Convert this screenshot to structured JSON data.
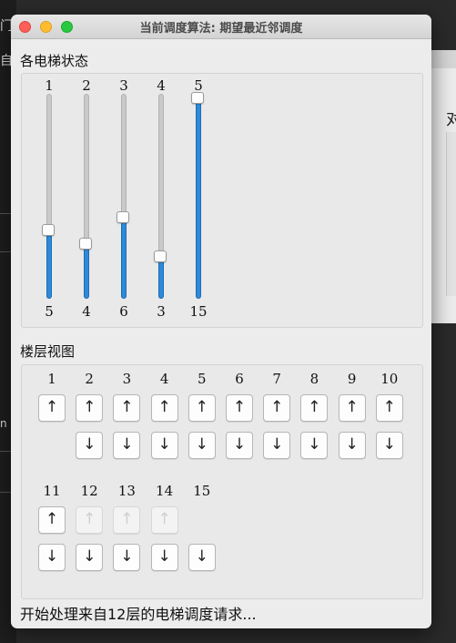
{
  "window": {
    "title": "当前调度算法: 期望最近邻调度"
  },
  "elevator_section": {
    "title": "各电梯状态",
    "max_floor": 15,
    "elevators": [
      {
        "id": "1",
        "floor": 5
      },
      {
        "id": "2",
        "floor": 4
      },
      {
        "id": "3",
        "floor": 6
      },
      {
        "id": "4",
        "floor": 3
      },
      {
        "id": "5",
        "floor": 15
      }
    ]
  },
  "floor_section": {
    "title": "楼层视图",
    "up_symbol": "↑",
    "down_symbol": "↓",
    "floors": [
      {
        "label": "1",
        "up": "enabled",
        "down": "none"
      },
      {
        "label": "2",
        "up": "enabled",
        "down": "enabled"
      },
      {
        "label": "3",
        "up": "enabled",
        "down": "enabled"
      },
      {
        "label": "4",
        "up": "enabled",
        "down": "enabled"
      },
      {
        "label": "5",
        "up": "enabled",
        "down": "enabled"
      },
      {
        "label": "6",
        "up": "enabled",
        "down": "enabled"
      },
      {
        "label": "7",
        "up": "enabled",
        "down": "enabled"
      },
      {
        "label": "8",
        "up": "enabled",
        "down": "enabled"
      },
      {
        "label": "9",
        "up": "enabled",
        "down": "enabled"
      },
      {
        "label": "10",
        "up": "enabled",
        "down": "enabled"
      },
      {
        "label": "11",
        "up": "enabled",
        "down": "enabled"
      },
      {
        "label": "12",
        "up": "disabled",
        "down": "enabled"
      },
      {
        "label": "13",
        "up": "disabled",
        "down": "enabled"
      },
      {
        "label": "14",
        "up": "disabled",
        "down": "enabled"
      },
      {
        "label": "15",
        "up": "none",
        "down": "enabled"
      }
    ]
  },
  "status_text": "开始处理来自12层的电梯调度请求...",
  "background": {
    "left_fragments": [
      "门",
      "自",
      "n"
    ],
    "right_fragment": "对"
  },
  "colors": {
    "accent": "#2e8ad8",
    "window_bg": "#ececec"
  }
}
